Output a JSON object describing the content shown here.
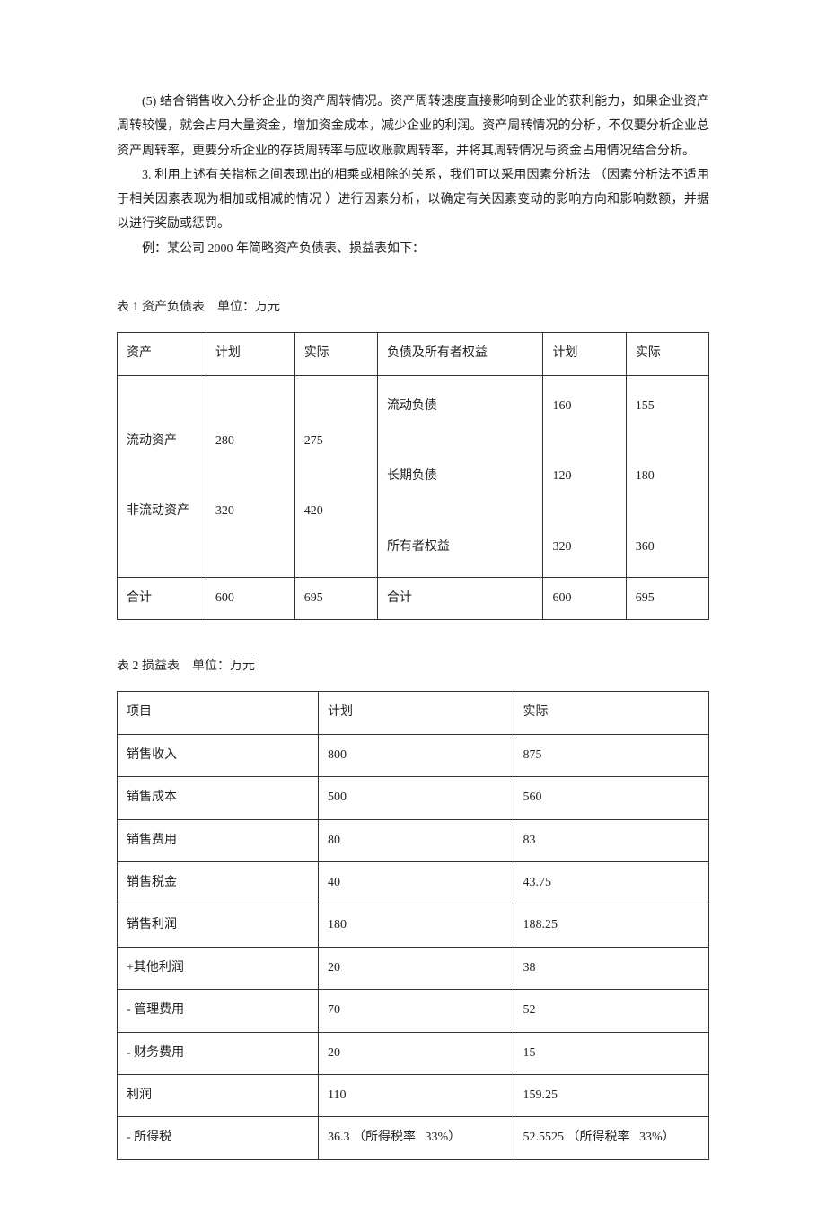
{
  "paragraphs": {
    "p1": "(5) 结合销售收入分析企业的资产周转情况。资产周转速度直接影响到企业的获利能力，如果企业资产周转较慢，就会占用大量资金，增加资金成本，减少企业的利润。资产周转情况的分析，不仅要分析企业总资产周转率，更要分析企业的存货周转率与应收账款周转率，并将其周转情况与资金占用情况结合分析。",
    "p2": "3. 利用上述有关指标之间表现出的相乘或相除的关系，我们可以采用因素分析法   （因素分析法不适用于相关因素表现为相加或相减的情况   ）进行因素分析，以确定有关因素变动的影响方向和影响数额，并据以进行奖励或惩罚。",
    "p3": "例：某公司   2000 年简略资产负债表、损益表如下："
  },
  "table1": {
    "caption": "表 1 资产负债表    单位：万元",
    "headers": {
      "h1": "资产",
      "h2": "计划",
      "h3": "实际",
      "h4": "负债及所有者权益",
      "h5": "计划",
      "h6": "实际"
    },
    "body": {
      "left_labels": "流动资产\n\n非流动资产",
      "left_plan": "280\n\n320",
      "left_actual": "275\n\n420",
      "right_labels": "流动负债\n\n长期负债\n\n所有者权益",
      "right_plan": "160\n\n120\n\n320",
      "right_actual": "155\n\n180\n\n360"
    },
    "total": {
      "t1": "合计",
      "t2": "600",
      "t3": "695",
      "t4": "合计",
      "t5": "600",
      "t6": "695"
    }
  },
  "table2": {
    "caption": "表 2 损益表    单位：万元",
    "headers": {
      "h1": "项目",
      "h2": "计划",
      "h3": "实际"
    },
    "rows": [
      {
        "c1": "销售收入",
        "c2": "800",
        "c3": "875"
      },
      {
        "c1": "销售成本",
        "c2": "500",
        "c3": "560"
      },
      {
        "c1": "销售费用",
        "c2": "80",
        "c3": "83"
      },
      {
        "c1": "销售税金",
        "c2": "40",
        "c3": "43.75"
      },
      {
        "c1": "销售利润",
        "c2": "180",
        "c3": "188.25"
      },
      {
        "c1": "+其他利润",
        "c2": "20",
        "c3": "38"
      },
      {
        "c1": "- 管理费用",
        "c2": "70",
        "c3": "52"
      },
      {
        "c1": "- 财务费用",
        "c2": "20",
        "c3": "15"
      },
      {
        "c1": "利润",
        "c2": "110",
        "c3": "159.25"
      },
      {
        "c1": "- 所得税",
        "c2": "36.3 （所得税率   33%）",
        "c3": "52.5525 （所得税率   33%）"
      }
    ]
  },
  "chart_data": [
    {
      "type": "table",
      "title": "资产负债表 (万元)",
      "series": [
        {
          "name": "资产-计划",
          "categories": [
            "流动资产",
            "非流动资产",
            "合计"
          ],
          "values": [
            280,
            320,
            600
          ]
        },
        {
          "name": "资产-实际",
          "categories": [
            "流动资产",
            "非流动资产",
            "合计"
          ],
          "values": [
            275,
            420,
            695
          ]
        },
        {
          "name": "负债及所有者权益-计划",
          "categories": [
            "流动负债",
            "长期负债",
            "所有者权益",
            "合计"
          ],
          "values": [
            160,
            120,
            320,
            600
          ]
        },
        {
          "name": "负债及所有者权益-实际",
          "categories": [
            "流动负债",
            "长期负债",
            "所有者权益",
            "合计"
          ],
          "values": [
            155,
            180,
            360,
            695
          ]
        }
      ]
    },
    {
      "type": "table",
      "title": "损益表 (万元)",
      "categories": [
        "销售收入",
        "销售成本",
        "销售费用",
        "销售税金",
        "销售利润",
        "+其他利润",
        "- 管理费用",
        "- 财务费用",
        "利润",
        "- 所得税"
      ],
      "series": [
        {
          "name": "计划",
          "values": [
            800,
            500,
            80,
            40,
            180,
            20,
            70,
            20,
            110,
            36.3
          ]
        },
        {
          "name": "实际",
          "values": [
            875,
            560,
            83,
            43.75,
            188.25,
            38,
            52,
            15,
            159.25,
            52.5525
          ]
        }
      ],
      "notes": "所得税率 33%"
    }
  ]
}
